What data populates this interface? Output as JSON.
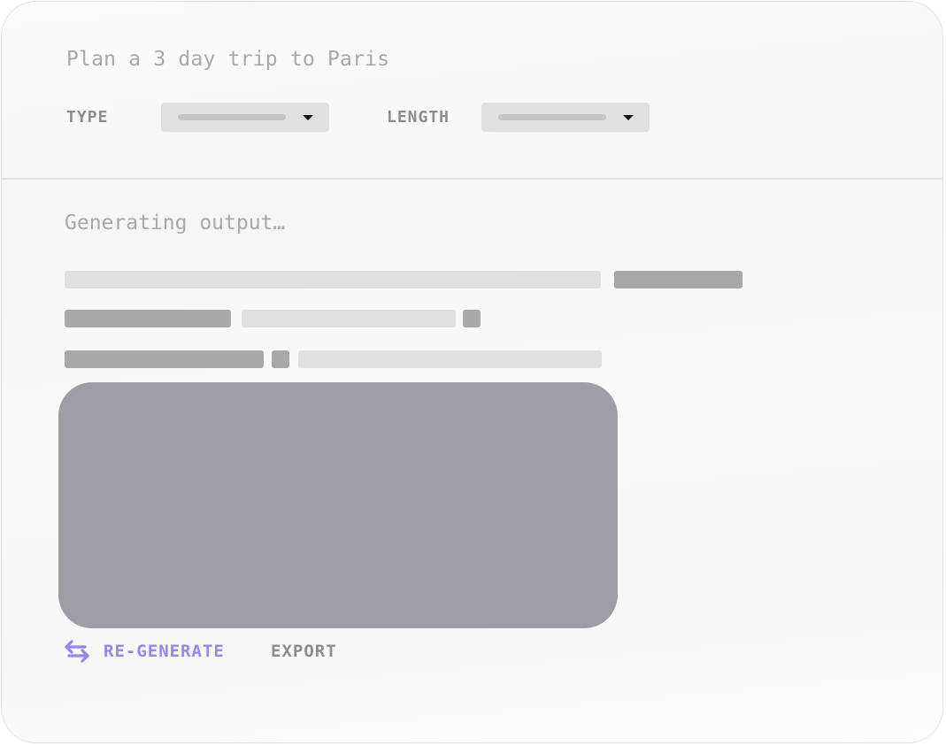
{
  "prompt": {
    "text": "Plan a 3 day trip to Paris"
  },
  "controls": {
    "type_label": "TYPE",
    "length_label": "LENGTH"
  },
  "output": {
    "status": "Generating output…"
  },
  "actions": {
    "regenerate_label": "RE-GENERATE",
    "regenerate_icon": "swap-arrows-icon",
    "export_label": "EXPORT"
  },
  "colors": {
    "accent": "#9a85ee",
    "skeleton_light": "#e0e0e0",
    "skeleton_dark": "#a8a8a8",
    "image_placeholder": "#9e9ea6"
  }
}
